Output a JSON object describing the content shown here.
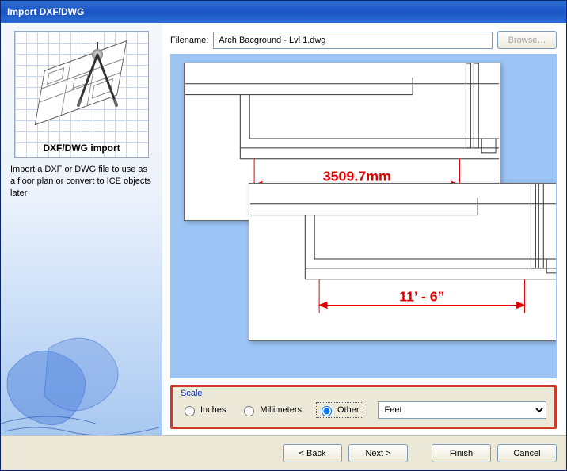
{
  "window": {
    "title": "Import DXF/DWG"
  },
  "sidebar": {
    "thumb_caption": "DXF/DWG import",
    "description": "Import a DXF or DWG file to use as a floor plan or convert to ICE objects later"
  },
  "file": {
    "label": "Filename:",
    "value": "Arch Bacground - Lvl 1.dwg",
    "browse_label": "Browse…"
  },
  "preview": {
    "dim1": "3509.7mm",
    "dim2": "11’ - 6”"
  },
  "scale": {
    "legend": "Scale",
    "options": {
      "inches": "Inches",
      "millimeters": "Millimeters",
      "other": "Other"
    },
    "selected": "other",
    "unit_selected": "Feet"
  },
  "footer": {
    "back": "< Back",
    "next": "Next >",
    "finish": "Finish",
    "cancel": "Cancel"
  }
}
